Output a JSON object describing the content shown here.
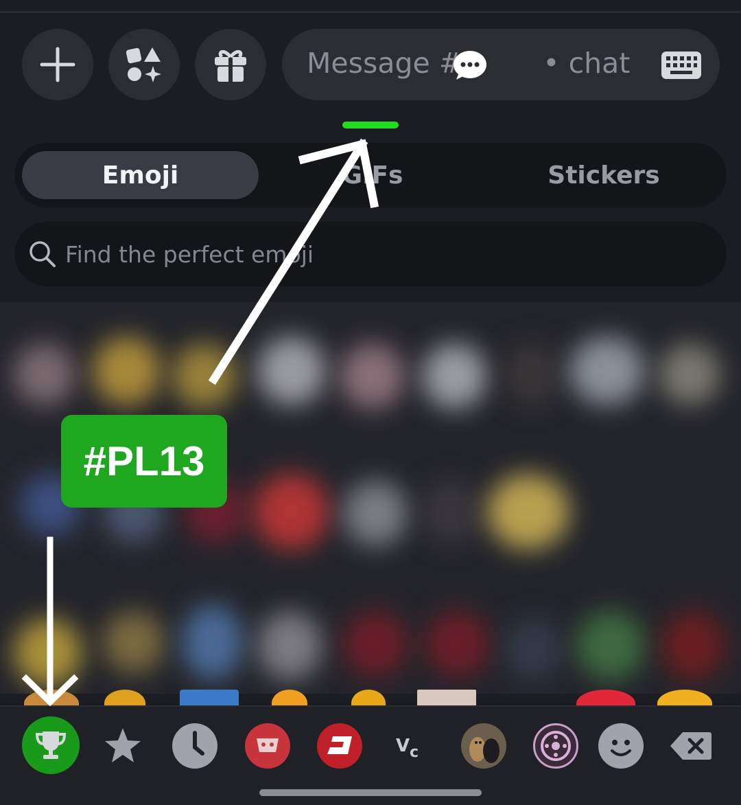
{
  "composer": {
    "message_placeholder": "Message #         • chat",
    "buttons": [
      "plus-icon",
      "apps-icon",
      "gift-icon"
    ],
    "keyboard_icon": "keyboard-icon"
  },
  "tabs": {
    "emoji": "Emoji",
    "gifs": "GIFs",
    "stickers": "Stickers",
    "active": "Emoji"
  },
  "search": {
    "placeholder": "Find the perfect emoji"
  },
  "annotation": {
    "tag": "#PL13"
  },
  "categories": [
    {
      "name": "trophy-icon",
      "selected": true
    },
    {
      "name": "star-icon"
    },
    {
      "name": "clock-icon"
    },
    {
      "name": "server-icon"
    },
    {
      "name": "server-icon"
    },
    {
      "name": "server-icon"
    },
    {
      "name": "server-icon"
    },
    {
      "name": "server-icon"
    },
    {
      "name": "smiley-icon"
    },
    {
      "name": "backspace-icon"
    }
  ],
  "colors": {
    "accent_green": "#22dd22",
    "tag_green": "#1fa81f",
    "selected_category": "#1a9a1a"
  }
}
